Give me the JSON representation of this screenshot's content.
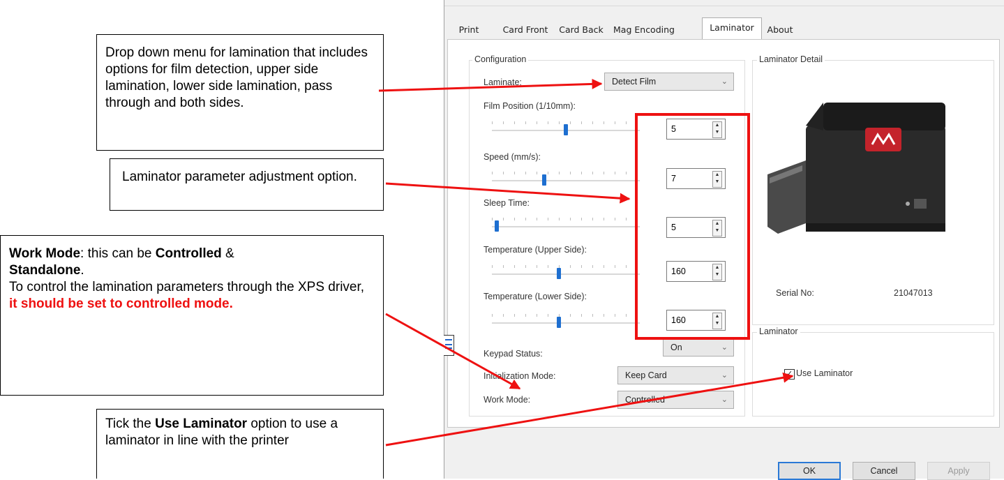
{
  "callouts": {
    "lamination_menu": "Drop down menu for lamination that includes options for film detection, upper side lamination, lower side lamination, pass through and both sides.",
    "parameter_adjust": "Laminator parameter adjustment option.",
    "work_mode": {
      "title": "Work Mode",
      "line1_mid": ": this can be ",
      "controlled": "Controlled",
      "amp": " & ",
      "standalone": "Standalone",
      "period": ".",
      "body": "To control the lamination parameters through the XPS driver, ",
      "red": "it should be set to controlled mode."
    },
    "use_laminator": {
      "pre": "Tick the ",
      "bold": "Use Laminator",
      "post": " option to use a laminator in line with the printer"
    }
  },
  "tabs": [
    "Print",
    "Card Front",
    "Card Back",
    "Mag Encoding",
    "Laminator",
    "About"
  ],
  "configuration": {
    "legend": "Configuration",
    "laminate_label": "Laminate:",
    "laminate_value": "Detect Film",
    "film_position_label": "Film Position (1/10mm):",
    "film_position_value": "5",
    "film_position_level": 0.5,
    "speed_label": "Speed (mm/s):",
    "speed_value": "7",
    "speed_level": 0.35,
    "sleep_time_label": "Sleep Time:",
    "sleep_time_value": "5",
    "sleep_time_level": 0.02,
    "temp_upper_label": "Temperature (Upper Side):",
    "temp_upper_value": "160",
    "temp_upper_level": 0.45,
    "temp_lower_label": "Temperature (Lower Side):",
    "temp_lower_value": "160",
    "temp_lower_level": 0.45,
    "keypad_label": "Keypad Status:",
    "keypad_value": "On",
    "init_label": "Initialization Mode:",
    "init_value": "Keep Card",
    "work_mode_label": "Work Mode:",
    "work_mode_value": "Controlled"
  },
  "detail": {
    "legend": "Laminator Detail",
    "serial_label": "Serial No:",
    "serial_value": "21047013"
  },
  "laminator_group": {
    "legend": "Laminator",
    "use_label": "Use Laminator",
    "use_checked": true,
    "check_glyph": "✓"
  },
  "buttons": {
    "ok": "OK",
    "cancel": "Cancel",
    "apply": "Apply"
  },
  "colors": {
    "accent_red": "#ee1111",
    "slider_blue": "#1e6fd0"
  }
}
